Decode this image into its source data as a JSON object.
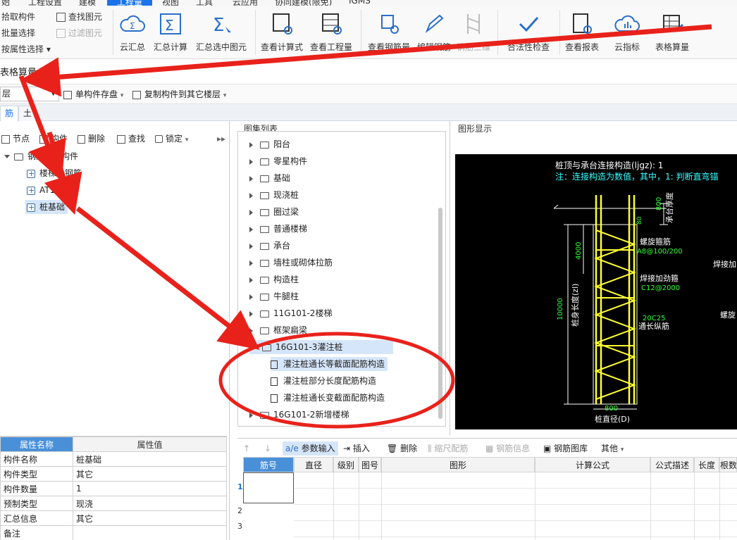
{
  "menubar": {
    "items": [
      "始",
      "工程设置",
      "建模",
      "工程量",
      "视图",
      "工具",
      "云应用",
      "协同建模(限免)",
      "IGMS"
    ]
  },
  "ribbon": {
    "left_small": [
      "拾取构件",
      "批量选择",
      "按属性选择",
      "查找图元",
      "过滤图元"
    ],
    "buttons": [
      "云汇总",
      "汇总计算",
      "汇总选中图元",
      "查看计算式",
      "查看工程量",
      "查看钢筋量",
      "编辑钢筋",
      "钢筋三维",
      "合法性检查",
      "查看报表",
      "云指标",
      "表格算量"
    ]
  },
  "title": "表格算量",
  "toolbar2": {
    "floor": "层",
    "save": "单构件存盘",
    "copy": "复制构件到其它楼层"
  },
  "tabs": [
    "筋",
    "土"
  ],
  "left_toolbar": [
    "节点",
    "构件",
    "删除",
    "查找",
    "锁定"
  ],
  "tree": {
    "root": "钢筋表格构件",
    "children": [
      "楼梯段钢筋",
      "AT1",
      "桩基础"
    ]
  },
  "properties": {
    "header_name": "属性名称",
    "header_value": "属性值",
    "rows": [
      {
        "name": "构件名称",
        "value": "桩基础"
      },
      {
        "name": "构件类型",
        "value": "其它"
      },
      {
        "name": "构件数量",
        "value": "1"
      },
      {
        "name": "预制类型",
        "value": "现浇"
      },
      {
        "name": "汇总信息",
        "value": "其它"
      },
      {
        "name": "备注",
        "value": ""
      }
    ]
  },
  "gallery": {
    "title": "图集列表",
    "items": [
      "阳台",
      "零星构件",
      "基础",
      "现浇桩",
      "圈过梁",
      "普通楼梯",
      "承台",
      "墙柱或砌体拉筋",
      "构造柱",
      "牛腿柱",
      "11G101-2楼梯",
      "框架扁梁"
    ],
    "expanded": "16G101-3灌注桩",
    "sub_items": [
      "灌注桩通长等截面配筋构造",
      "灌注桩部分长度配筋构造",
      "灌注桩通长变截面配筋构造"
    ],
    "last": "16G101-2新增楼梯"
  },
  "graphic": {
    "title": "图形显示",
    "line1": "桩顶与承台连接构造(ljgz): 1",
    "line2": "注：连接构造为数值，其中，1: 判断直弯锚",
    "label_cap": "承台厚度",
    "dim_800_top": "800",
    "dim_4000": "4000",
    "len_text": "桩身长度(zl)",
    "dim_10000": "10000",
    "spiral": "螺旋箍筋",
    "spiral_val": "A8@100/200",
    "weld": "焊接加劲箍",
    "weld_val": "C12@2000",
    "long_val": "20C25",
    "long": "通长纵筋",
    "dim_800_bottom": "800",
    "diameter": "桩直径(D)",
    "right1": "焊接加",
    "right2": "螺旋",
    "dim_80": "80"
  },
  "grid": {
    "toolbar": [
      "参数输入",
      "插入",
      "删除",
      "缩尺配筋",
      "钢筋信息",
      "钢筋图库",
      "其他"
    ],
    "headers": [
      "筋号",
      "直径(mm)",
      "级别",
      "图号",
      "图形",
      "计算公式",
      "公式描述",
      "长度",
      "根数"
    ],
    "rows": [
      "1",
      "2",
      "3"
    ]
  },
  "colors": {
    "accent": "#1a73e8",
    "header_blue": "#4a90d9",
    "cad_yellow": "#ffff33",
    "cad_green": "#33ff33",
    "cad_cyan": "#33ffff",
    "arrow_red": "#e8221b"
  }
}
